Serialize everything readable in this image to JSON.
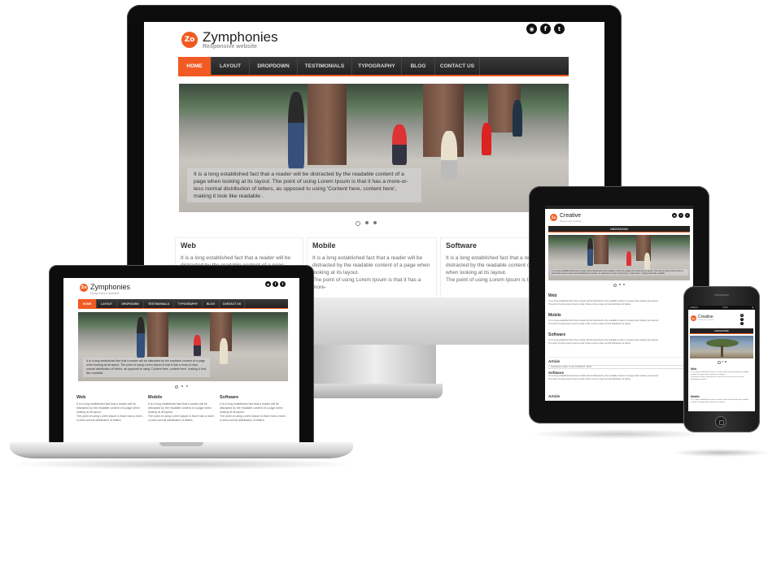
{
  "site": {
    "brand": "Zymphonies",
    "tagline": "Responsive website",
    "logo_letters": "Zo",
    "nav": [
      "Home",
      "Layout",
      "Dropdown",
      "Testimonials",
      "Typography",
      "Blog",
      "Contact us"
    ],
    "slider_caption": "It is a long established fact that a reader will be distracted by the readable content of a page when looking at its layout. The point of using Lorem Ipsum is that it has a more-or-less normal distribution of letters, as opposed to using 'Content here, content here', making it look like readable .",
    "columns": [
      {
        "title": "Web",
        "text": "It is a long established fact that a reader will be distracted by the readable content of a page when looking at its layout."
      },
      {
        "title": "Mobile",
        "text": "It is a long established fact that a reader will be distracted by the readable content of a page when looking at its layout.",
        "text2": "The point of using Lorem Ipsum is that it has a more-"
      },
      {
        "title": "Software",
        "text": "It is a long established fact that a reader will be distracted by the readable content of a page when looking at its layout.",
        "text2": "The point of using Lorem Ipsum is tha"
      }
    ],
    "laptop_columns": [
      {
        "title": "Web",
        "text": "It is a long established fact that a reader will be distracted by the readable content of a page when looking at its layout.",
        "text2": "The point of using Lorem Ipsum is that it has a more-or-less normal distribution of letters."
      },
      {
        "title": "Mobile",
        "text": "It is a long established fact that a reader will be distracted by the readable content of a page when looking at its layout.",
        "text2": "The point of using Lorem Ipsum is that it has a more-or-less normal distribution of letters."
      },
      {
        "title": "Software",
        "text": "It is a long established fact that a reader will be distracted by the readable content of a page when looking at its layout.",
        "text2": "The point of using Lorem Ipsum is that it has a more-or-less normal distribution of letters."
      }
    ]
  },
  "tablet": {
    "brand": "Creative",
    "tagline": "Responsive website",
    "nav_label": "NAVIGATION",
    "sections": [
      "Web",
      "Mobile",
      "Software"
    ],
    "section_text": "It is a long established fact that a reader will be distracted by the readable content of a page when looking at its layout.",
    "section_text2": "The point of using Lorem Ipsum is that it has a more-or-less normal distribution of letters.",
    "article_heading": "Article",
    "article_meta": "Submitted by admin on Sat, 11/30/2013 - 08:30",
    "article_title": "Software",
    "article2_heading": "Article"
  },
  "phone": {
    "status_carrier": "vodafone",
    "status_time": "03:30",
    "brand": "Creative",
    "tagline": "Responsive website",
    "nav_label": "NAVIGATION",
    "sections": [
      "Web",
      "Mobile"
    ],
    "section_text": "It is a long established fact that a reader will be distracted by the readable content of a page when looking at its layout.",
    "section_text2": "The point of using Lorem Ipsum is that it has a more-or-less normal distribution of letters."
  },
  "social_icons": [
    "rss-icon",
    "facebook-icon",
    "twitter-icon"
  ],
  "colors": {
    "accent": "#f15a22",
    "nav": "#2a2a2a",
    "device": "#111111"
  }
}
